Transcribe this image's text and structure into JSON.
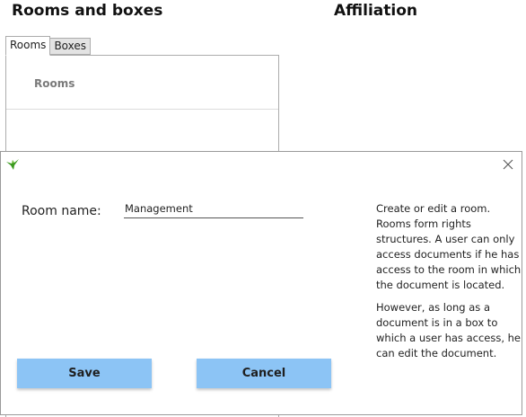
{
  "page": {
    "rooms_heading": "Rooms and boxes",
    "affiliation_heading": "Affiliation"
  },
  "tabs": [
    {
      "label": "Rooms",
      "active": true
    },
    {
      "label": "Boxes",
      "active": false
    }
  ],
  "rooms_panel": {
    "header": "Rooms"
  },
  "dialog": {
    "logo_icon": "bird-logo-icon",
    "close_icon": "close-icon",
    "field_label": "Room name:",
    "field_value": "Management",
    "help_paragraphs": [
      "Create or edit a room. Rooms form rights structures. A user can only access documents if he has access to the room in which the document is located.",
      "However, as long as a document is in a box to which a user has access, he can edit the document."
    ],
    "save_label": "Save",
    "cancel_label": "Cancel"
  },
  "colors": {
    "button_bg": "#8cc4f5",
    "logo_green": "#3a9a1e"
  }
}
